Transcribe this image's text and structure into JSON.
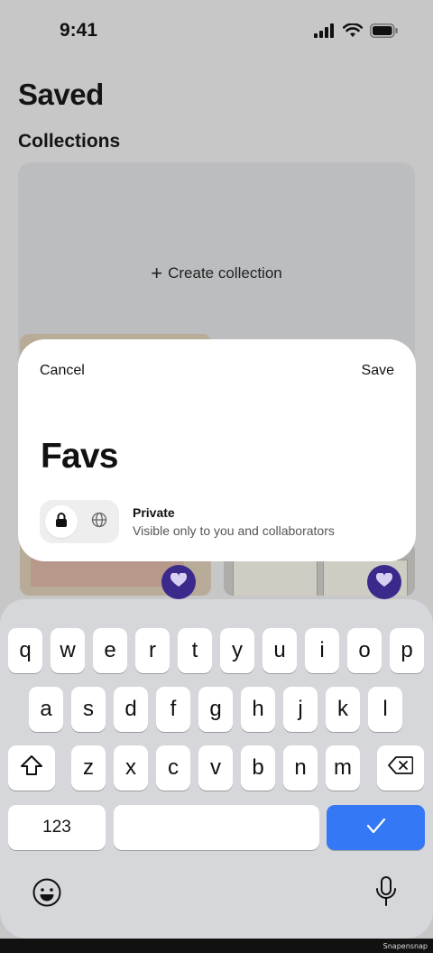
{
  "status_bar": {
    "time": "9:41"
  },
  "page": {
    "title": "Saved",
    "section": "Collections"
  },
  "create_collection": {
    "label": "Create collection"
  },
  "dialog": {
    "cancel_label": "Cancel",
    "save_label": "Save",
    "collection_name": "Favs",
    "privacy_title": "Private",
    "privacy_description": "Visible only to you and collaborators"
  },
  "keyboard": {
    "row1": [
      "q",
      "w",
      "e",
      "r",
      "t",
      "y",
      "u",
      "i",
      "o",
      "p"
    ],
    "row2": [
      "a",
      "s",
      "d",
      "f",
      "g",
      "h",
      "j",
      "k",
      "l"
    ],
    "row3": [
      "z",
      "x",
      "c",
      "v",
      "b",
      "n",
      "m"
    ],
    "numbers_label": "123",
    "done_glyph": "✓",
    "done_color": "#3478f6"
  },
  "watermark": "Snapensnap",
  "colors": {
    "heart_button": "#3b2a8c"
  }
}
